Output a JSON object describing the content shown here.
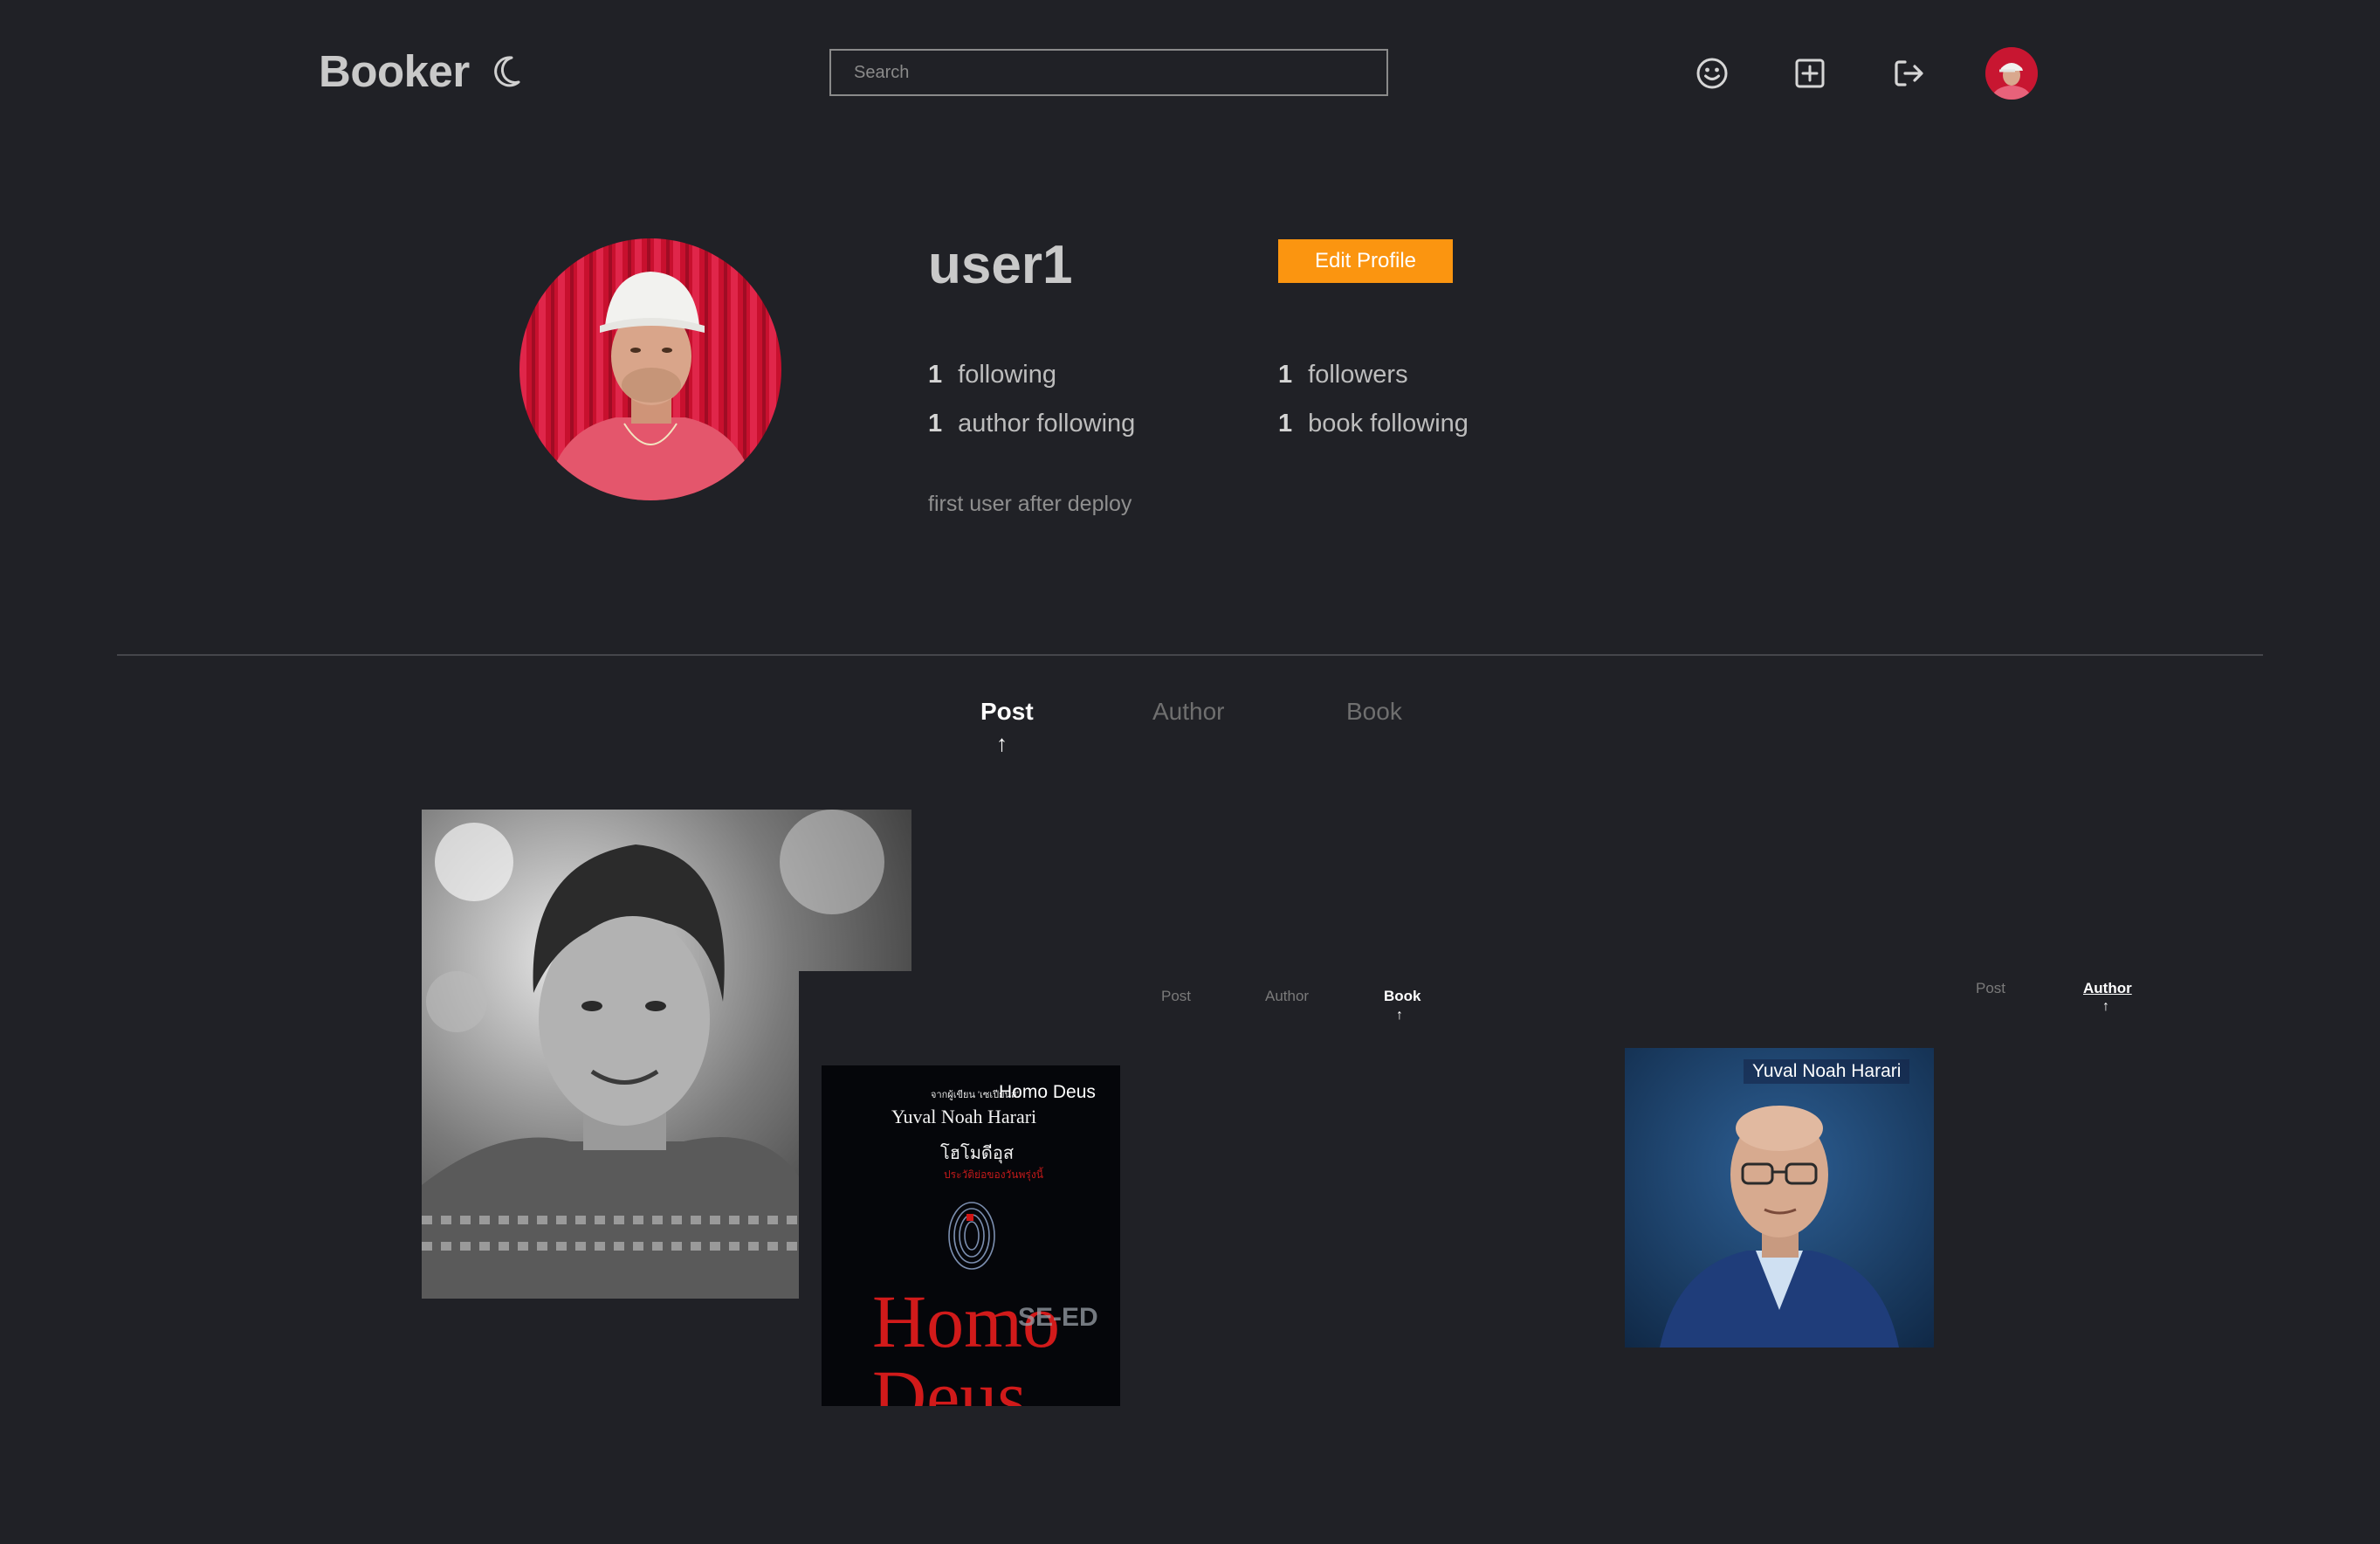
{
  "header": {
    "brand": "Booker",
    "search_placeholder": "Search",
    "icons": [
      "moon-icon",
      "smiley-icon",
      "add-square-icon",
      "logout-icon"
    ]
  },
  "profile": {
    "username": "user1",
    "edit_label": "Edit Profile",
    "stats": {
      "following": {
        "num": "1",
        "label": "following"
      },
      "followers": {
        "num": "1",
        "label": "followers"
      },
      "author_following": {
        "num": "1",
        "label": "author following"
      },
      "book_following": {
        "num": "1",
        "label": "book following"
      }
    },
    "bio": "first user after deploy"
  },
  "tabs": {
    "post": "Post",
    "author": "Author",
    "book": "Book",
    "active": "Post"
  },
  "posts": {
    "book_tabs": {
      "post": "Post",
      "author": "Author",
      "book": "Book",
      "active": "Book"
    },
    "book_cover": {
      "line1_thai": "จากผู้เขียน 'เซเปียนส์'",
      "title_en": "Homo Deus",
      "author": "Yuval Noah Harari",
      "title_thai": "โฮโมดีอุส",
      "subtitle_thai": "ประวัติย่อของวันพรุ่งนี้",
      "title_big": "Homo Deus",
      "publisher": "SE-ED"
    },
    "author_tabs": {
      "post": "Post",
      "author": "Author",
      "active": "Author"
    },
    "author_card": {
      "name": "Yuval Noah Harari"
    }
  },
  "colors": {
    "background": "#202126",
    "accent": "#fb9510",
    "divider": "#45464b"
  }
}
